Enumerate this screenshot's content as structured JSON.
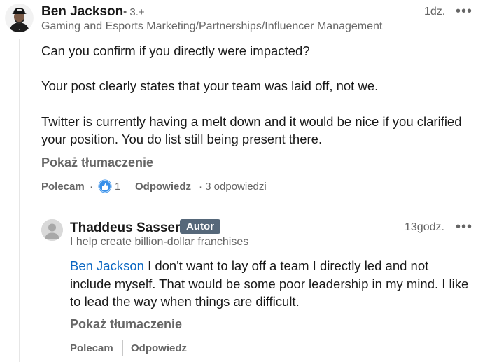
{
  "comment": {
    "author": "Ben Jackson",
    "degree": "• 3.+",
    "headline": "Gaming and Esports Marketing/Partnerships/Influencer Management",
    "time": "1dz.",
    "more": "•••",
    "body": [
      "Can you confirm if you directly were impacted?",
      "Your post clearly states that your team was laid off, not we.",
      "Twitter is currently having a melt down and it would be nice if you clarified",
      "your position. You do list still being present there."
    ],
    "translate": "Pokaż tłumaczenie",
    "actions": {
      "like": "Polecam",
      "dot": "·",
      "like_count": "1",
      "reply": "Odpowiedz",
      "replies_count": "· 3 odpowiedzi"
    }
  },
  "reply": {
    "author": "Thaddeus Sasser",
    "badge": "Autor",
    "headline": "I help create billion-dollar franchises",
    "time": "13godz.",
    "more": "•••",
    "mention": "Ben Jackson",
    "body": [
      " I don't want to lay off a team I directly led and not",
      "include myself. That would be some poor leadership in my mind. I like",
      "to lead the way when things are difficult."
    ],
    "translate": "Pokaż tłumaczenie",
    "actions": {
      "like": "Polecam",
      "reply": "Odpowiedz"
    }
  },
  "colors": {
    "link": "#0a66c2",
    "badge_bg": "#56687a",
    "muted": "#666666"
  },
  "icons": [
    "profile-photo",
    "more-icon",
    "like-reaction-icon"
  ]
}
